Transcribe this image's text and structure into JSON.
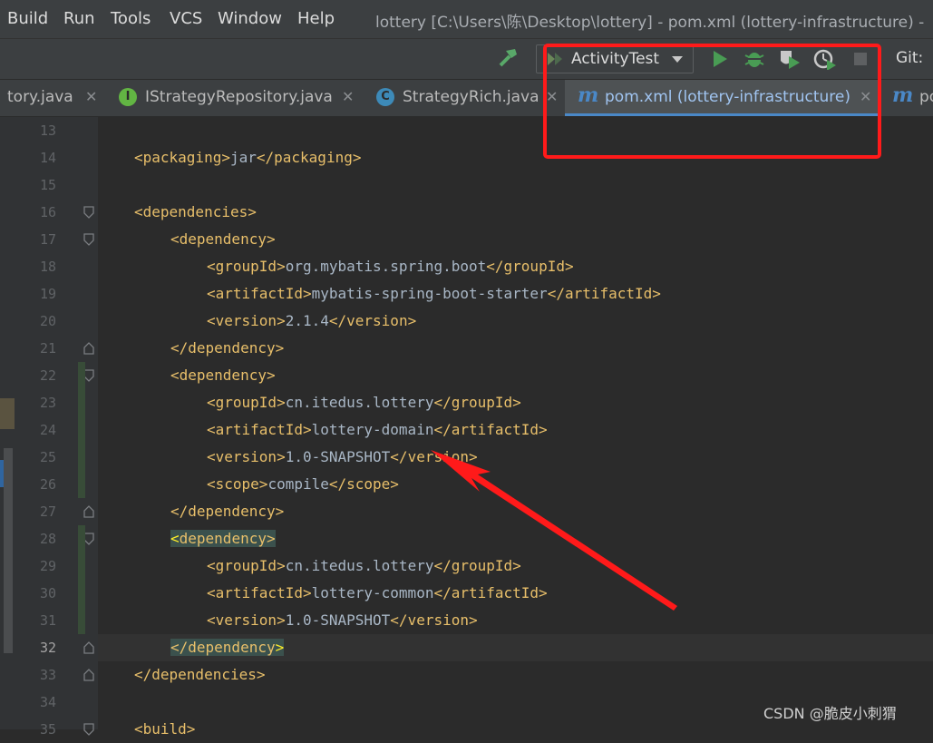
{
  "menu": [
    "Build",
    "Run",
    "Tools",
    "VCS",
    "Window",
    "Help"
  ],
  "window_title": "lottery [C:\\Users\\陈\\Desktop\\lottery] - pom.xml (lottery-infrastructure) -",
  "toolbar": {
    "run_config": "ActivityTest",
    "git_label": "Git:"
  },
  "tabs": [
    {
      "label": "tory.java",
      "icon_letter": ""
    },
    {
      "label": "IStrategyRepository.java",
      "icon_letter": "I"
    },
    {
      "label": "StrategyRich.java",
      "icon_letter": "C"
    },
    {
      "label": "pom.xml (lottery-infrastructure)",
      "icon_letter": "m"
    },
    {
      "label": "po",
      "icon_letter": "m"
    }
  ],
  "lines": [
    {
      "n": "13",
      "text": []
    },
    {
      "n": "14",
      "text": [
        [
          "tag",
          "<packaging>"
        ],
        [
          "txt",
          "jar"
        ],
        [
          "tag",
          "</packaging>"
        ]
      ]
    },
    {
      "n": "15",
      "text": []
    },
    {
      "n": "16",
      "text": [
        [
          "tag",
          "<dependencies>"
        ]
      ]
    },
    {
      "n": "17",
      "text": [
        [
          "tag",
          "<dependency>"
        ]
      ]
    },
    {
      "n": "18",
      "text": [
        [
          "tag",
          "<groupId>"
        ],
        [
          "txt",
          "org.mybatis.spring.boot"
        ],
        [
          "tag",
          "</groupId>"
        ]
      ]
    },
    {
      "n": "19",
      "text": [
        [
          "tag",
          "<artifactId>"
        ],
        [
          "txt",
          "mybatis-spring-boot-starter"
        ],
        [
          "tag",
          "</artifactId>"
        ]
      ]
    },
    {
      "n": "20",
      "text": [
        [
          "tag",
          "<version>"
        ],
        [
          "txt",
          "2.1.4"
        ],
        [
          "tag",
          "</version>"
        ]
      ]
    },
    {
      "n": "21",
      "text": [
        [
          "tag",
          "</dependency>"
        ]
      ]
    },
    {
      "n": "22",
      "text": [
        [
          "tag",
          "<dependency>"
        ]
      ]
    },
    {
      "n": "23",
      "text": [
        [
          "tag",
          "<groupId>"
        ],
        [
          "txt",
          "cn.itedus.lottery"
        ],
        [
          "tag",
          "</groupId>"
        ]
      ]
    },
    {
      "n": "24",
      "text": [
        [
          "tag",
          "<artifactId>"
        ],
        [
          "txt",
          "lottery-domain"
        ],
        [
          "tag",
          "</artifactId>"
        ]
      ]
    },
    {
      "n": "25",
      "text": [
        [
          "tag",
          "<version>"
        ],
        [
          "txt",
          "1.0-SNAPSHOT"
        ],
        [
          "tag",
          "</version>"
        ]
      ]
    },
    {
      "n": "26",
      "text": [
        [
          "tag",
          "<scope>"
        ],
        [
          "txt",
          "compile"
        ],
        [
          "tag",
          "</scope>"
        ]
      ]
    },
    {
      "n": "27",
      "text": [
        [
          "tag",
          "</dependency>"
        ]
      ]
    },
    {
      "n": "28",
      "text": [
        [
          "hl-tag-yellow",
          "<"
        ],
        [
          "hl-tag",
          "dependency>"
        ]
      ]
    },
    {
      "n": "29",
      "text": [
        [
          "tag",
          "<groupId>"
        ],
        [
          "txt",
          "cn.itedus.lottery"
        ],
        [
          "tag",
          "</groupId>"
        ]
      ]
    },
    {
      "n": "30",
      "text": [
        [
          "tag",
          "<artifactId>"
        ],
        [
          "txt",
          "lottery-common"
        ],
        [
          "tag",
          "</artifactId>"
        ]
      ]
    },
    {
      "n": "31",
      "text": [
        [
          "tag",
          "<version>"
        ],
        [
          "txt",
          "1.0-SNAPSHOT"
        ],
        [
          "tag",
          "</version>"
        ]
      ]
    },
    {
      "n": "32",
      "text": [
        [
          "hl-tag",
          "</dependency"
        ],
        [
          "hl-tag-yellow",
          ">"
        ]
      ]
    },
    {
      "n": "33",
      "text": [
        [
          "tag",
          "</dependencies>"
        ]
      ]
    },
    {
      "n": "34",
      "text": []
    },
    {
      "n": "35",
      "text": [
        [
          "tag",
          "<build>"
        ]
      ]
    }
  ],
  "current_line": "32",
  "watermark": "CSDN @脆皮小刺猬",
  "colors": {
    "annotation_red": "#ff1a1a",
    "tag": "#e8bf6a",
    "text": "#a9b7c6",
    "accent": "#4a88c7"
  }
}
